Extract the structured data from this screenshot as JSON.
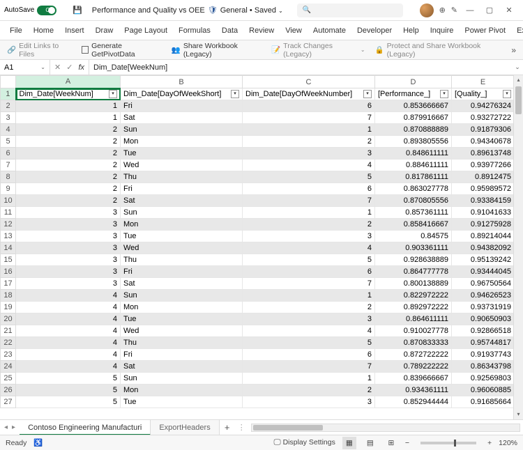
{
  "titlebar": {
    "autosave_label": "AutoSave",
    "autosave_state": "On",
    "filename": "Performance and Quality vs OEE",
    "sensitivity": "General",
    "save_state": "Saved",
    "search_placeholder": "Search"
  },
  "ribbon_tabs": [
    "File",
    "Home",
    "Insert",
    "Draw",
    "Page Layout",
    "Formulas",
    "Data",
    "Review",
    "View",
    "Automate",
    "Developer",
    "Help",
    "Inquire",
    "Power Pivot",
    "Ex"
  ],
  "ribbon_cmds": {
    "edit_links": "Edit Links to Files",
    "gen_pivot": "Generate GetPivotData",
    "share_wb": "Share Workbook (Legacy)",
    "track_changes": "Track Changes (Legacy)",
    "protect_share": "Protect and Share Workbook (Legacy)"
  },
  "namebox": "A1",
  "formula": "Dim_Date[WeekNum]",
  "columns": [
    "A",
    "B",
    "C",
    "D",
    "E"
  ],
  "headers": [
    "Dim_Date[WeekNum]",
    "Dim_Date[DayOfWeekShort]",
    "Dim_Date[DayOfWeekNumber]",
    "[Performance_]",
    "[Quality_]"
  ],
  "rows": [
    {
      "n": 2,
      "w": "1",
      "d": "Fri",
      "dn": "6",
      "p": "0.853666667",
      "q": "0.94276324"
    },
    {
      "n": 3,
      "w": "1",
      "d": "Sat",
      "dn": "7",
      "p": "0.879916667",
      "q": "0.93272722"
    },
    {
      "n": 4,
      "w": "2",
      "d": "Sun",
      "dn": "1",
      "p": "0.870888889",
      "q": "0.91879306"
    },
    {
      "n": 5,
      "w": "2",
      "d": "Mon",
      "dn": "2",
      "p": "0.893805556",
      "q": "0.94340678"
    },
    {
      "n": 6,
      "w": "2",
      "d": "Tue",
      "dn": "3",
      "p": "0.848611111",
      "q": "0.89613748"
    },
    {
      "n": 7,
      "w": "2",
      "d": "Wed",
      "dn": "4",
      "p": "0.884611111",
      "q": "0.93977266"
    },
    {
      "n": 8,
      "w": "2",
      "d": "Thu",
      "dn": "5",
      "p": "0.817861111",
      "q": "0.8912475"
    },
    {
      "n": 9,
      "w": "2",
      "d": "Fri",
      "dn": "6",
      "p": "0.863027778",
      "q": "0.95989572"
    },
    {
      "n": 10,
      "w": "2",
      "d": "Sat",
      "dn": "7",
      "p": "0.870805556",
      "q": "0.93384159"
    },
    {
      "n": 11,
      "w": "3",
      "d": "Sun",
      "dn": "1",
      "p": "0.857361111",
      "q": "0.91041633"
    },
    {
      "n": 12,
      "w": "3",
      "d": "Mon",
      "dn": "2",
      "p": "0.858416667",
      "q": "0.91275928"
    },
    {
      "n": 13,
      "w": "3",
      "d": "Tue",
      "dn": "3",
      "p": "0.84575",
      "q": "0.89214044"
    },
    {
      "n": 14,
      "w": "3",
      "d": "Wed",
      "dn": "4",
      "p": "0.903361111",
      "q": "0.94382092"
    },
    {
      "n": 15,
      "w": "3",
      "d": "Thu",
      "dn": "5",
      "p": "0.928638889",
      "q": "0.95139242"
    },
    {
      "n": 16,
      "w": "3",
      "d": "Fri",
      "dn": "6",
      "p": "0.864777778",
      "q": "0.93444045"
    },
    {
      "n": 17,
      "w": "3",
      "d": "Sat",
      "dn": "7",
      "p": "0.800138889",
      "q": "0.96750564"
    },
    {
      "n": 18,
      "w": "4",
      "d": "Sun",
      "dn": "1",
      "p": "0.822972222",
      "q": "0.94626523"
    },
    {
      "n": 19,
      "w": "4",
      "d": "Mon",
      "dn": "2",
      "p": "0.892972222",
      "q": "0.93731919"
    },
    {
      "n": 20,
      "w": "4",
      "d": "Tue",
      "dn": "3",
      "p": "0.864611111",
      "q": "0.90650903"
    },
    {
      "n": 21,
      "w": "4",
      "d": "Wed",
      "dn": "4",
      "p": "0.910027778",
      "q": "0.92866518"
    },
    {
      "n": 22,
      "w": "4",
      "d": "Thu",
      "dn": "5",
      "p": "0.870833333",
      "q": "0.95744817"
    },
    {
      "n": 23,
      "w": "4",
      "d": "Fri",
      "dn": "6",
      "p": "0.872722222",
      "q": "0.91937743"
    },
    {
      "n": 24,
      "w": "4",
      "d": "Sat",
      "dn": "7",
      "p": "0.789222222",
      "q": "0.86343798"
    },
    {
      "n": 25,
      "w": "5",
      "d": "Sun",
      "dn": "1",
      "p": "0.839666667",
      "q": "0.92569803"
    },
    {
      "n": 26,
      "w": "5",
      "d": "Mon",
      "dn": "2",
      "p": "0.934361111",
      "q": "0.96060885"
    },
    {
      "n": 27,
      "w": "5",
      "d": "Tue",
      "dn": "3",
      "p": "0.852944444",
      "q": "0.91685664"
    }
  ],
  "sheets": {
    "active": "Contoso Engineering Manufacturi",
    "second": "ExportHeaders"
  },
  "statusbar": {
    "ready": "Ready",
    "display_settings": "Display Settings",
    "zoom": "120%"
  }
}
